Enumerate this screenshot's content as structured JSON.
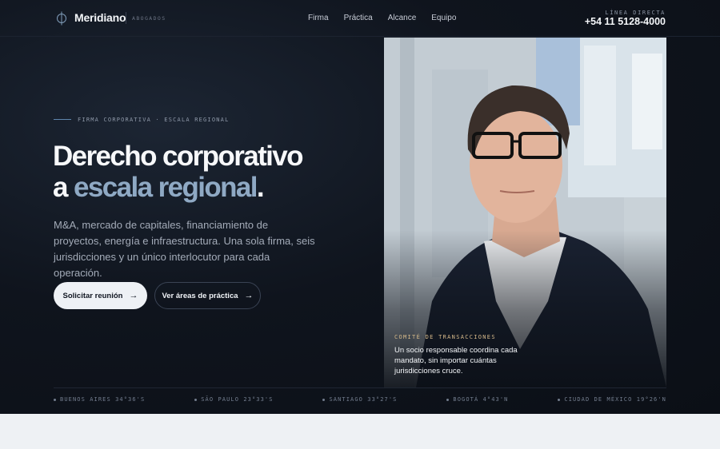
{
  "header": {
    "brand": "Meridiano",
    "brand_sub": "ABOGADOS",
    "nav": [
      "Firma",
      "Práctica",
      "Alcance",
      "Equipo"
    ],
    "contact_label": "LÍNEA DIRECTA",
    "contact_phone": "+54 11 5128-4000"
  },
  "hero": {
    "eyebrow": "FIRMA CORPORATIVA · ESCALA REGIONAL",
    "headline_line1": "Derecho corporativo",
    "headline_line2_prefix": "a ",
    "headline_line2_accent": "escala regional",
    "headline_line2_suffix": ".",
    "lead": "M&A, mercado de capitales, financiamiento de proyectos, energía e infraestructura. Una sola firma, seis jurisdicciones y un único interlocutor para cada operación.",
    "cta_primary": "Solicitar reunión",
    "cta_secondary": "Ver áreas de práctica",
    "cta_arrow": "→"
  },
  "photo": {
    "caption_label": "COMITÉ DE TRANSACCIONES",
    "caption": "Un socio responsable coordina cada mandato, sin importar cuántas jurisdicciones cruce."
  },
  "cities": [
    "BUENOS AIRES 34°36'S",
    "SÃO PAULO 23°33'S",
    "SANTIAGO 33°27'S",
    "BOGOTÁ 4°43'N",
    "CIUDAD DE MÉXICO 19°26'N"
  ],
  "colors": {
    "hero_bg": "#0b0f16",
    "accent": "#8fa9c4",
    "caption_gold": "#d6b98a",
    "page_bg": "#eef1f4"
  }
}
